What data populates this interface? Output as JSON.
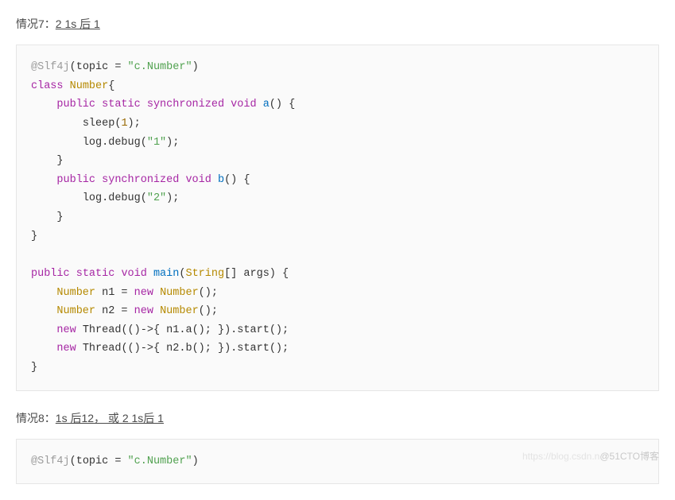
{
  "headings": {
    "h7_prefix": "情况7：",
    "h7_underlined": "2 1s 后 1",
    "h8_prefix": "情况8：",
    "h8_underlined": "1s 后12， 或 2 1s后 1"
  },
  "code": {
    "topic_str": "\"c.Number\"",
    "sleep_arg": "1",
    "debug1": "\"1\"",
    "debug2": "\"2\"",
    "kw_class": "class",
    "kw_public": "public",
    "kw_static": "static",
    "kw_synchronized": "synchronized",
    "kw_void": "void",
    "kw_new": "new",
    "type_Number": "Number",
    "type_StringArr": "String",
    "fn_a": "a",
    "fn_b": "b",
    "fn_main": "main",
    "anno": "@Slf4j",
    "id_Number": "Number",
    "id_n1": "n1",
    "id_n2": "n2",
    "id_Thread": "Thread",
    "id_args": "args",
    "id_topic": "topic",
    "id_sleep": "sleep",
    "id_log": "log",
    "id_debug": "debug",
    "id_start": "start"
  },
  "watermark": {
    "left": "https://blog.csdn.n",
    "right": "@51CTO博客"
  }
}
